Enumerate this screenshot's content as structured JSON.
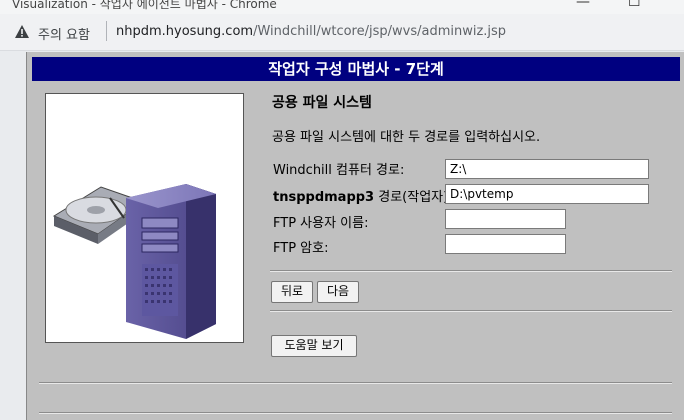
{
  "browser": {
    "window_title": "Visualization - 작업자 에이전트 마법사 - Chrome",
    "security_label": "주의 요함",
    "url_host": "nhpdm.hyosung.com",
    "url_path": "/Windchill/wtcore/jsp/wvs/adminwiz.jsp"
  },
  "wizard": {
    "title": "작업자 구성 마법사 - 7단계",
    "section_title": "공용 파일 시스템",
    "description": "공용 파일 시스템에 대한 두 경로를 입력하십시오.",
    "fields": {
      "windchill_path_label": "Windchill 컴퓨터 경로:",
      "windchill_path_value": "Z:\\",
      "worker_host": "tnsppdmapp3",
      "worker_path_label": " 경로(작업자):",
      "worker_path_value": "D:\\pvtemp",
      "ftp_user_label": "FTP 사용자 이름:",
      "ftp_user_value": "",
      "ftp_password_label": "FTP 암호:",
      "ftp_password_value": ""
    },
    "buttons": {
      "back": "뒤로",
      "next": "다음",
      "help": "도움말 보기"
    }
  }
}
